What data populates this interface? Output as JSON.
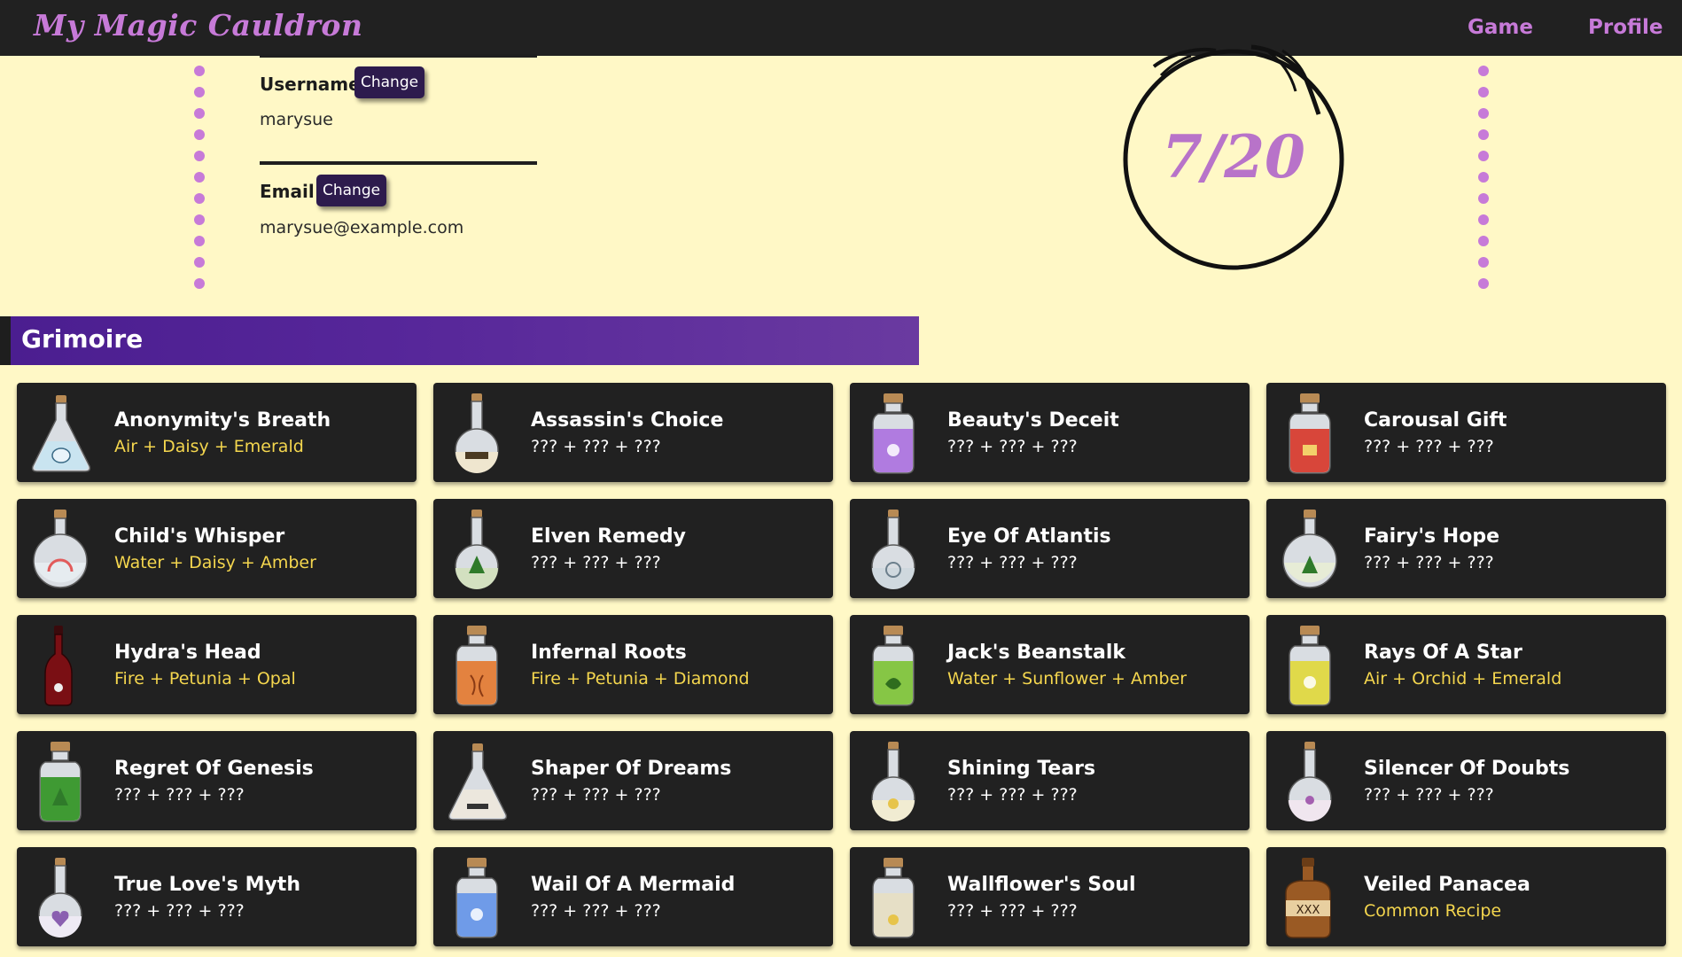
{
  "header": {
    "logo": "My Magic Cauldron",
    "nav": {
      "game": "Game",
      "profile": "Profile"
    }
  },
  "profile": {
    "username_label": "Username",
    "username_value": "marysue",
    "email_label": "Email",
    "email_value": "marysue@example.com",
    "change_label": "Change",
    "score": "7/20"
  },
  "grimoire": {
    "title": "Grimoire",
    "potions": [
      {
        "name": "Anonymity's Breath",
        "recipe": "Air + Daisy + Emerald",
        "known": true,
        "shape": "flask",
        "color": "#c9e4f0",
        "symbol": "mask"
      },
      {
        "name": "Assassin's Choice",
        "recipe": "??? + ??? + ???",
        "known": false,
        "shape": "vial",
        "color": "#efe6cf",
        "symbol": "bones"
      },
      {
        "name": "Beauty's Deceit",
        "recipe": "??? + ??? + ???",
        "known": false,
        "shape": "jar",
        "color": "#b07be0",
        "symbol": "flower"
      },
      {
        "name": "Carousal Gift",
        "recipe": "??? + ??? + ???",
        "known": false,
        "shape": "jar",
        "color": "#d8463a",
        "symbol": "cup"
      },
      {
        "name": "Child's Whisper",
        "recipe": "Water + Daisy + Amber",
        "known": true,
        "shape": "round",
        "color": "#e6ecf0",
        "symbol": "rainbow"
      },
      {
        "name": "Elven Remedy",
        "recipe": "??? + ??? + ???",
        "known": false,
        "shape": "vial",
        "color": "#d3e0c0",
        "symbol": "tree"
      },
      {
        "name": "Eye Of Atlantis",
        "recipe": "??? + ??? + ???",
        "known": false,
        "shape": "vial",
        "color": "#cfd8de",
        "symbol": "swirl"
      },
      {
        "name": "Fairy's Hope",
        "recipe": "??? + ??? + ???",
        "known": false,
        "shape": "round",
        "color": "#e7ecd6",
        "symbol": "tree"
      },
      {
        "name": "Hydra's Head",
        "recipe": "Fire + Petunia + Opal",
        "known": true,
        "shape": "bottle",
        "color": "#7a0f14",
        "symbol": "skull"
      },
      {
        "name": "Infernal Roots",
        "recipe": "Fire + Petunia + Diamond",
        "known": true,
        "shape": "jar",
        "color": "#e3823f",
        "symbol": "roots"
      },
      {
        "name": "Jack's Beanstalk",
        "recipe": "Water + Sunflower + Amber",
        "known": true,
        "shape": "jar",
        "color": "#86c645",
        "symbol": "leaf"
      },
      {
        "name": "Rays Of A Star",
        "recipe": "Air + Orchid + Emerald",
        "known": true,
        "shape": "jar",
        "color": "#e0d94a",
        "symbol": "flower"
      },
      {
        "name": "Regret Of Genesis",
        "recipe": "??? + ??? + ???",
        "known": false,
        "shape": "jar",
        "color": "#3f9a33",
        "symbol": "tree"
      },
      {
        "name": "Shaper Of Dreams",
        "recipe": "??? + ??? + ???",
        "known": false,
        "shape": "flask",
        "color": "#ece7dd",
        "symbol": "anvil"
      },
      {
        "name": "Shining Tears",
        "recipe": "??? + ??? + ???",
        "known": false,
        "shape": "vial",
        "color": "#f1ecd2",
        "symbol": "sun"
      },
      {
        "name": "Silencer Of Doubts",
        "recipe": "??? + ??? + ???",
        "known": false,
        "shape": "vial",
        "color": "#f0e6ef",
        "symbol": "figure"
      },
      {
        "name": "True Love's Myth",
        "recipe": "??? + ??? + ???",
        "known": false,
        "shape": "vial",
        "color": "#eeeaf4",
        "symbol": "heart"
      },
      {
        "name": "Wail Of A Mermaid",
        "recipe": "??? + ??? + ???",
        "known": false,
        "shape": "jar",
        "color": "#6f9be8",
        "symbol": "flower"
      },
      {
        "name": "Wallflower's Soul",
        "recipe": "??? + ??? + ???",
        "known": false,
        "shape": "jar",
        "color": "#e6dfc6",
        "symbol": "sun"
      },
      {
        "name": "Veiled Panacea",
        "recipe": "Common Recipe",
        "known": true,
        "shape": "jug",
        "color": "#9a5a24",
        "symbol": "xxx"
      }
    ]
  }
}
